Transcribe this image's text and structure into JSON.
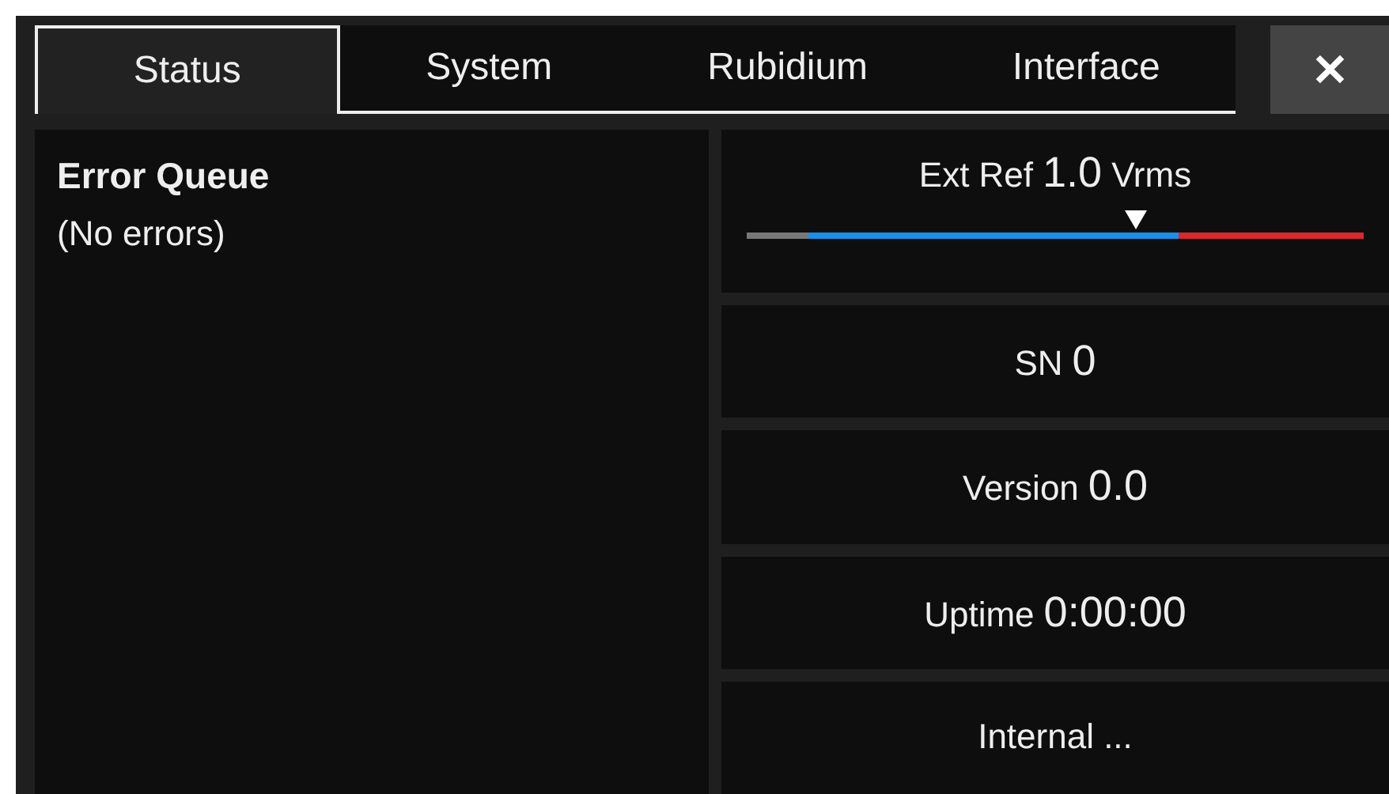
{
  "tabs": [
    {
      "label": "Status",
      "selected": true
    },
    {
      "label": "System",
      "selected": false
    },
    {
      "label": "Rubidium",
      "selected": false
    },
    {
      "label": "Interface",
      "selected": false
    }
  ],
  "close_button": {
    "label": "✕"
  },
  "error_queue": {
    "title": "Error Queue",
    "message": "(No errors)"
  },
  "ext_ref": {
    "label": "Ext Ref",
    "value": "1.0",
    "unit": "Vrms",
    "level": 0.63
  },
  "info_rows": [
    {
      "label": "SN",
      "value": "0"
    },
    {
      "label": "Version",
      "value": "0.0"
    },
    {
      "label": "Uptime",
      "value": "0:00:00"
    },
    {
      "label": "Internal ..."
    }
  ]
}
